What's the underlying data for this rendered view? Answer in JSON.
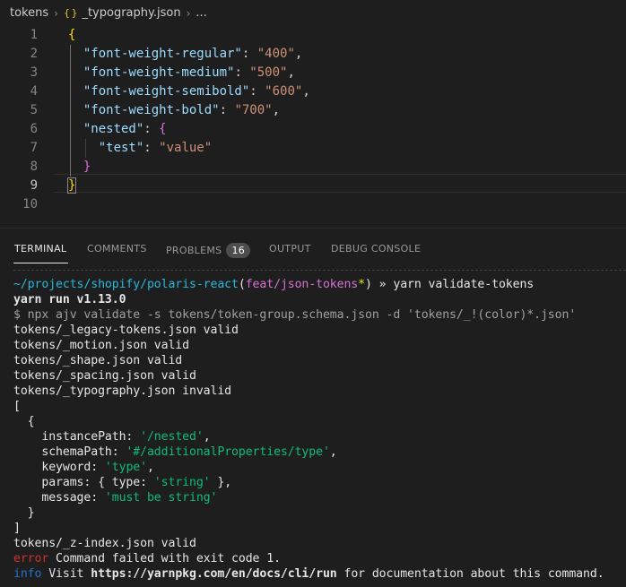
{
  "breadcrumb": {
    "folder": "tokens",
    "file_icon": "{ }",
    "file": "_typography.json",
    "more": "..."
  },
  "editor": {
    "lines": [
      {
        "num": "1",
        "tokens": [
          [
            "b1",
            "{"
          ]
        ]
      },
      {
        "num": "2",
        "tokens": [
          [
            "p",
            "  "
          ],
          [
            "k",
            "\"font-weight-regular\""
          ],
          [
            "p",
            ": "
          ],
          [
            "s",
            "\"400\""
          ],
          [
            "p",
            ","
          ]
        ]
      },
      {
        "num": "3",
        "tokens": [
          [
            "p",
            "  "
          ],
          [
            "k",
            "\"font-weight-medium\""
          ],
          [
            "p",
            ": "
          ],
          [
            "s",
            "\"500\""
          ],
          [
            "p",
            ","
          ]
        ]
      },
      {
        "num": "4",
        "tokens": [
          [
            "p",
            "  "
          ],
          [
            "k",
            "\"font-weight-semibold\""
          ],
          [
            "p",
            ": "
          ],
          [
            "s",
            "\"600\""
          ],
          [
            "p",
            ","
          ]
        ]
      },
      {
        "num": "5",
        "tokens": [
          [
            "p",
            "  "
          ],
          [
            "k",
            "\"font-weight-bold\""
          ],
          [
            "p",
            ": "
          ],
          [
            "s",
            "\"700\""
          ],
          [
            "p",
            ","
          ]
        ]
      },
      {
        "num": "6",
        "tokens": [
          [
            "p",
            "  "
          ],
          [
            "k",
            "\"nested\""
          ],
          [
            "p",
            ": "
          ],
          [
            "b2",
            "{"
          ]
        ]
      },
      {
        "num": "7",
        "tokens": [
          [
            "p",
            "    "
          ],
          [
            "k",
            "\"test\""
          ],
          [
            "p",
            ": "
          ],
          [
            "s",
            "\"value\""
          ]
        ]
      },
      {
        "num": "8",
        "tokens": [
          [
            "p",
            "  "
          ],
          [
            "b2",
            "}"
          ]
        ]
      },
      {
        "num": "9",
        "tokens": [
          [
            "b1",
            "}"
          ]
        ]
      },
      {
        "num": "10",
        "tokens": []
      }
    ],
    "active_line": "9"
  },
  "panel": {
    "tabs": [
      {
        "label": "TERMINAL",
        "active": true
      },
      {
        "label": "COMMENTS",
        "active": false
      },
      {
        "label": "PROBLEMS",
        "active": false,
        "badge": "16"
      },
      {
        "label": "OUTPUT",
        "active": false
      },
      {
        "label": "DEBUG CONSOLE",
        "active": false
      }
    ]
  },
  "terminal": {
    "lines": [
      [
        [
          "cyan",
          "~/projects/shopify/polaris-react"
        ],
        [
          "white",
          "("
        ],
        [
          "magenta",
          "feat/json-tokens"
        ],
        [
          "yellow",
          "*"
        ],
        [
          "white",
          ") » yarn validate-tokens"
        ]
      ],
      [
        [
          "bold white",
          "yarn run v1.13.0"
        ]
      ],
      [
        [
          "gray",
          "$ npx ajv validate -s tokens/token-group.schema.json -d 'tokens/_!(color)*.json'"
        ]
      ],
      [
        [
          "white",
          "tokens/_legacy-tokens.json valid"
        ]
      ],
      [
        [
          "white",
          "tokens/_motion.json valid"
        ]
      ],
      [
        [
          "white",
          "tokens/_shape.json valid"
        ]
      ],
      [
        [
          "white",
          "tokens/_spacing.json valid"
        ]
      ],
      [
        [
          "white",
          "tokens/_typography.json invalid"
        ]
      ],
      [
        [
          "white",
          "["
        ]
      ],
      [
        [
          "white",
          "  {"
        ]
      ],
      [
        [
          "white",
          "    instancePath: "
        ],
        [
          "green",
          "'/nested'"
        ],
        [
          "white",
          ","
        ]
      ],
      [
        [
          "white",
          "    schemaPath: "
        ],
        [
          "green",
          "'#/additionalProperties/type'"
        ],
        [
          "white",
          ","
        ]
      ],
      [
        [
          "white",
          "    keyword: "
        ],
        [
          "green",
          "'type'"
        ],
        [
          "white",
          ","
        ]
      ],
      [
        [
          "white",
          "    params: { type: "
        ],
        [
          "green",
          "'string'"
        ],
        [
          "white",
          " },"
        ]
      ],
      [
        [
          "white",
          "    message: "
        ],
        [
          "green",
          "'must be string'"
        ]
      ],
      [
        [
          "white",
          "  }"
        ]
      ],
      [
        [
          "white",
          "]"
        ]
      ],
      [
        [
          "white",
          "tokens/_z-index.json valid"
        ]
      ],
      [
        [
          "red",
          "error"
        ],
        [
          "white",
          " Command failed with exit code 1."
        ]
      ],
      [
        [
          "blue",
          "info"
        ],
        [
          "white",
          " Visit "
        ],
        [
          "bold white",
          "https://yarnpkg.com/en/docs/cli/run"
        ],
        [
          "white",
          " for documentation about this command."
        ]
      ]
    ]
  }
}
